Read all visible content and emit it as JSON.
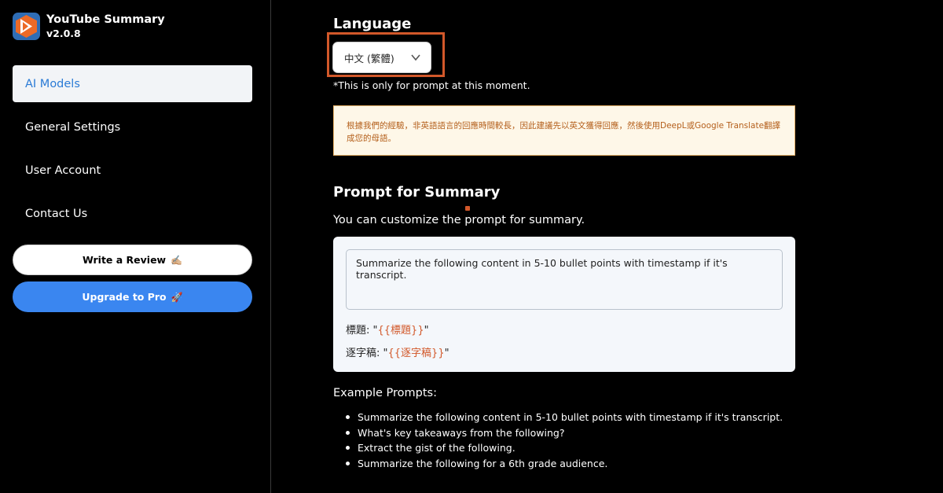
{
  "sidebar": {
    "app_title": "YouTube Summary",
    "version": "v2.0.8",
    "nav": [
      {
        "label": "AI Models",
        "active": true
      },
      {
        "label": "General Settings",
        "active": false
      },
      {
        "label": "User Account",
        "active": false
      },
      {
        "label": "Contact Us",
        "active": false
      }
    ],
    "review_label": "Write a Review",
    "review_emoji": "✍🏼",
    "upgrade_label": "Upgrade to Pro",
    "upgrade_emoji": "🚀"
  },
  "language": {
    "heading": "Language",
    "selected": "中文 (繁體)",
    "note": "*This is only for prompt at this moment.",
    "warning": "根據我們的經驗，非英語語言的回應時間較長，因此建議先以英文獲得回應，然後使用DeepL或Google Translate翻譯成您的母語。"
  },
  "prompt": {
    "heading": "Prompt for Summary",
    "subtitle": "You can customize the prompt for summary.",
    "textarea_value": "Summarize the following content in 5-10 bullet points with timestamp if it's transcript.",
    "title_label": "標題: \"",
    "title_token": "{{標題}}",
    "transcript_label": "逐字稿: \"",
    "transcript_token": "{{逐字稿}}",
    "quote_close": "\""
  },
  "examples": {
    "heading": "Example Prompts:",
    "items": [
      "Summarize the following content in 5-10 bullet points with timestamp if it's transcript.",
      "What's key takeaways from the following?",
      "Extract the gist of the following.",
      "Summarize the following for a 6th grade audience."
    ]
  },
  "colors": {
    "accent": "#3a86f0",
    "highlight": "#d2582a",
    "warning_text": "#b45f1b"
  }
}
